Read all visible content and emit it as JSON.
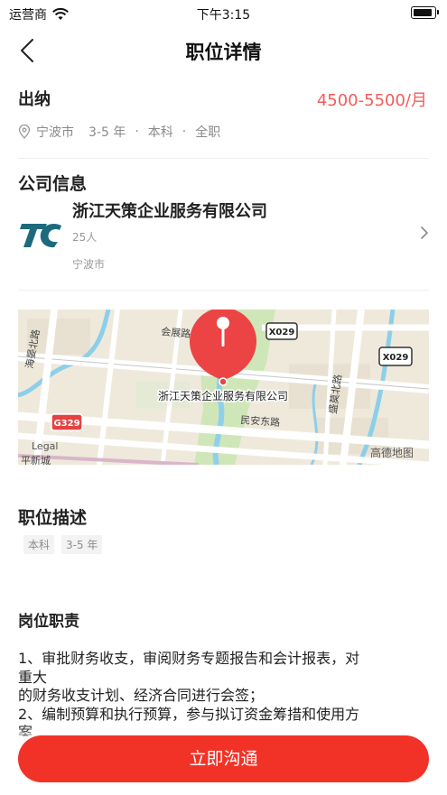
{
  "status_bar": {
    "carrier": "运营商",
    "time": "下午3:15"
  },
  "nav": {
    "title": "职位详情"
  },
  "job": {
    "title": "出纳",
    "salary": "4500-5500/月",
    "city": "宁波市",
    "experience": "3-5 年",
    "education": "本科",
    "type": "全职",
    "dot": "·"
  },
  "company_section": {
    "heading": "公司信息",
    "name": "浙江天策企业服务有限公司",
    "size": "25人",
    "city": "宁波市",
    "logo_text": "TC"
  },
  "map": {
    "pin_label": "浙江天策企业服务有限公司",
    "roads": [
      "会展路",
      "民安东路",
      "海晏北路",
      "盛莫北路"
    ],
    "route_badges": [
      "X029",
      "X029",
      "G329"
    ],
    "attribution": "高德地图",
    "legal": "Legal",
    "corner_text": "平新城"
  },
  "description": {
    "heading": "职位描述",
    "tags": [
      "本科",
      "3-5 年"
    ]
  },
  "duties": {
    "heading": "岗位职责",
    "lines": [
      "1、审批财务收支，审阅财务专题报告和会计报表，对",
      "重大",
      "的财务收支计划、经济合同进行会签；",
      "2、编制预算和执行预算，参与拟订资金筹措和使用方",
      "案"
    ]
  },
  "cta": {
    "label": "立即沟通"
  },
  "colors": {
    "salary": "#f25b5b",
    "cta": "#f23227",
    "pin": "#ec4445"
  }
}
